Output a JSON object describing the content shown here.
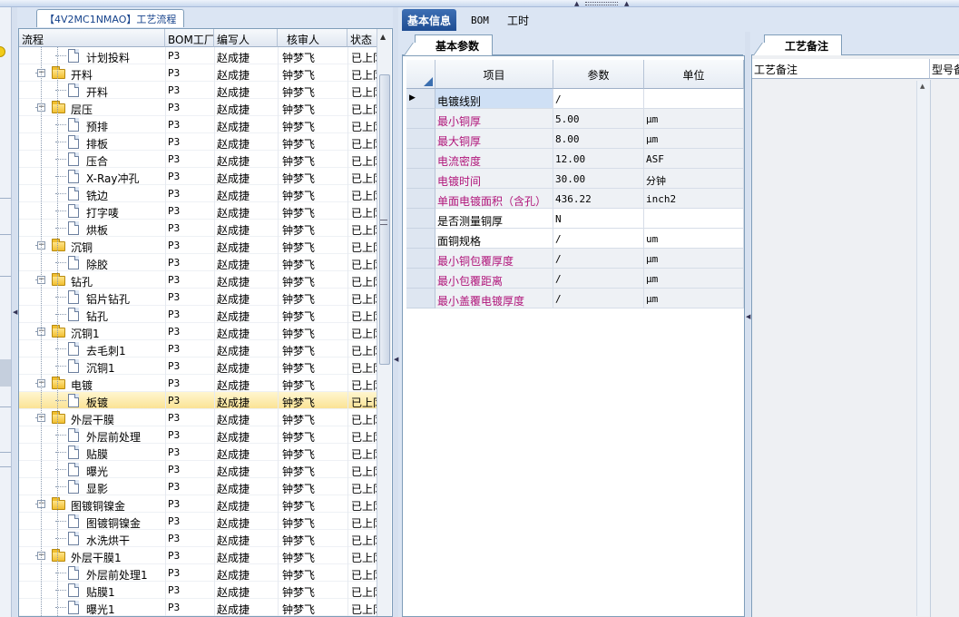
{
  "window": {
    "panel_title": "【4V2MC1NMAO】工艺流程"
  },
  "tree": {
    "columns": [
      "流程",
      "BOM工厂",
      "编写人",
      "核审人",
      "状态"
    ],
    "rows": [
      {
        "name": "计划投料",
        "level": 1,
        "type": "doc",
        "bom": "P3",
        "writer": "赵成捷",
        "reviewer": "钟梦飞",
        "status": "已上冈"
      },
      {
        "name": "开料",
        "level": 0,
        "type": "folder",
        "bom": "P3",
        "writer": "赵成捷",
        "reviewer": "钟梦飞",
        "status": "已上冈"
      },
      {
        "name": "开料",
        "level": 1,
        "type": "doc",
        "bom": "P3",
        "writer": "赵成捷",
        "reviewer": "钟梦飞",
        "status": "已上冈"
      },
      {
        "name": "层压",
        "level": 0,
        "type": "folder",
        "bom": "P3",
        "writer": "赵成捷",
        "reviewer": "钟梦飞",
        "status": "已上冈"
      },
      {
        "name": "预排",
        "level": 1,
        "type": "doc",
        "bom": "P3",
        "writer": "赵成捷",
        "reviewer": "钟梦飞",
        "status": "已上冈"
      },
      {
        "name": "排板",
        "level": 1,
        "type": "doc",
        "bom": "P3",
        "writer": "赵成捷",
        "reviewer": "钟梦飞",
        "status": "已上冈"
      },
      {
        "name": "压合",
        "level": 1,
        "type": "doc",
        "bom": "P3",
        "writer": "赵成捷",
        "reviewer": "钟梦飞",
        "status": "已上冈"
      },
      {
        "name": "X-Ray冲孔",
        "level": 1,
        "type": "doc",
        "bom": "P3",
        "writer": "赵成捷",
        "reviewer": "钟梦飞",
        "status": "已上冈"
      },
      {
        "name": "铣边",
        "level": 1,
        "type": "doc",
        "bom": "P3",
        "writer": "赵成捷",
        "reviewer": "钟梦飞",
        "status": "已上冈"
      },
      {
        "name": "打字唛",
        "level": 1,
        "type": "doc",
        "bom": "P3",
        "writer": "赵成捷",
        "reviewer": "钟梦飞",
        "status": "已上冈"
      },
      {
        "name": "烘板",
        "level": 1,
        "type": "doc",
        "bom": "P3",
        "writer": "赵成捷",
        "reviewer": "钟梦飞",
        "status": "已上冈"
      },
      {
        "name": "沉铜",
        "level": 0,
        "type": "folder",
        "bom": "P3",
        "writer": "赵成捷",
        "reviewer": "钟梦飞",
        "status": "已上冈"
      },
      {
        "name": "除胶",
        "level": 1,
        "type": "doc",
        "bom": "P3",
        "writer": "赵成捷",
        "reviewer": "钟梦飞",
        "status": "已上冈"
      },
      {
        "name": "钻孔",
        "level": 0,
        "type": "folder",
        "bom": "P3",
        "writer": "赵成捷",
        "reviewer": "钟梦飞",
        "status": "已上冈"
      },
      {
        "name": "铝片钻孔",
        "level": 1,
        "type": "doc",
        "bom": "P3",
        "writer": "赵成捷",
        "reviewer": "钟梦飞",
        "status": "已上冈"
      },
      {
        "name": "钻孔",
        "level": 1,
        "type": "doc",
        "bom": "P3",
        "writer": "赵成捷",
        "reviewer": "钟梦飞",
        "status": "已上冈"
      },
      {
        "name": "沉铜1",
        "level": 0,
        "type": "folder",
        "bom": "P3",
        "writer": "赵成捷",
        "reviewer": "钟梦飞",
        "status": "已上冈"
      },
      {
        "name": "去毛刺1",
        "level": 1,
        "type": "doc",
        "bom": "P3",
        "writer": "赵成捷",
        "reviewer": "钟梦飞",
        "status": "已上冈"
      },
      {
        "name": "沉铜1",
        "level": 1,
        "type": "doc",
        "bom": "P3",
        "writer": "赵成捷",
        "reviewer": "钟梦飞",
        "status": "已上冈"
      },
      {
        "name": "电镀",
        "level": 0,
        "type": "folder",
        "bom": "P3",
        "writer": "赵成捷",
        "reviewer": "钟梦飞",
        "status": "已上冈"
      },
      {
        "name": "板镀",
        "level": 1,
        "type": "doc",
        "bom": "P3",
        "writer": "赵成捷",
        "reviewer": "钟梦飞",
        "status": "已上冈",
        "selected": true
      },
      {
        "name": "外层干膜",
        "level": 0,
        "type": "folder",
        "bom": "P3",
        "writer": "赵成捷",
        "reviewer": "钟梦飞",
        "status": "已上冈"
      },
      {
        "name": "外层前处理",
        "level": 1,
        "type": "doc",
        "bom": "P3",
        "writer": "赵成捷",
        "reviewer": "钟梦飞",
        "status": "已上冈"
      },
      {
        "name": "贴膜",
        "level": 1,
        "type": "doc",
        "bom": "P3",
        "writer": "赵成捷",
        "reviewer": "钟梦飞",
        "status": "已上冈"
      },
      {
        "name": "曝光",
        "level": 1,
        "type": "doc",
        "bom": "P3",
        "writer": "赵成捷",
        "reviewer": "钟梦飞",
        "status": "已上冈"
      },
      {
        "name": "显影",
        "level": 1,
        "type": "doc",
        "bom": "P3",
        "writer": "赵成捷",
        "reviewer": "钟梦飞",
        "status": "已上冈"
      },
      {
        "name": "图镀铜镍金",
        "level": 0,
        "type": "folder",
        "bom": "P3",
        "writer": "赵成捷",
        "reviewer": "钟梦飞",
        "status": "已上冈"
      },
      {
        "name": "图镀铜镍金",
        "level": 1,
        "type": "doc",
        "bom": "P3",
        "writer": "赵成捷",
        "reviewer": "钟梦飞",
        "status": "已上冈"
      },
      {
        "name": "水洗烘干",
        "level": 1,
        "type": "doc",
        "bom": "P3",
        "writer": "赵成捷",
        "reviewer": "钟梦飞",
        "status": "已上冈"
      },
      {
        "name": "外层干膜1",
        "level": 0,
        "type": "folder",
        "bom": "P3",
        "writer": "赵成捷",
        "reviewer": "钟梦飞",
        "status": "已上冈"
      },
      {
        "name": "外层前处理1",
        "level": 1,
        "type": "doc",
        "bom": "P3",
        "writer": "赵成捷",
        "reviewer": "钟梦飞",
        "status": "已上冈"
      },
      {
        "name": "贴膜1",
        "level": 1,
        "type": "doc",
        "bom": "P3",
        "writer": "赵成捷",
        "reviewer": "钟梦飞",
        "status": "已上冈"
      },
      {
        "name": "曝光1",
        "level": 1,
        "type": "doc",
        "bom": "P3",
        "writer": "赵成捷",
        "reviewer": "钟梦飞",
        "status": "已上冈"
      }
    ]
  },
  "main_tabs": [
    "基本信息",
    "BOM",
    "工时"
  ],
  "params": {
    "tab_label": "基本参数",
    "columns": [
      "项目",
      "参数",
      "单位"
    ],
    "rows": [
      {
        "item": "电镀线别",
        "value": "/",
        "unit": "",
        "highlight": false,
        "current": true
      },
      {
        "item": "最小铜厚",
        "value": "5.00",
        "unit": "μm",
        "highlight": true
      },
      {
        "item": "最大铜厚",
        "value": "8.00",
        "unit": "μm",
        "highlight": true
      },
      {
        "item": "电流密度",
        "value": "12.00",
        "unit": "ASF",
        "highlight": true
      },
      {
        "item": "电镀时间",
        "value": "30.00",
        "unit": "分钟",
        "highlight": true
      },
      {
        "item": "单面电镀面积（含孔）",
        "value": "436.22",
        "unit": "inch2",
        "highlight": true
      },
      {
        "item": "是否测量铜厚",
        "value": "N",
        "unit": "",
        "highlight": false
      },
      {
        "item": "面铜规格",
        "value": "/",
        "unit": "um",
        "highlight": false
      },
      {
        "item": "最小铜包覆厚度",
        "value": "/",
        "unit": "μm",
        "highlight": true
      },
      {
        "item": "最小包覆距离",
        "value": "/",
        "unit": "μm",
        "highlight": true
      },
      {
        "item": "最小盖覆电镀厚度",
        "value": "/",
        "unit": "μm",
        "highlight": true
      }
    ]
  },
  "notes": {
    "tab_label": "工艺备注",
    "columns": [
      "工艺备注",
      "型号备"
    ]
  },
  "colors": {
    "highlight_text": "#b0157a",
    "tab_active": "#1f4d92",
    "selected_row": "#fbe395"
  }
}
